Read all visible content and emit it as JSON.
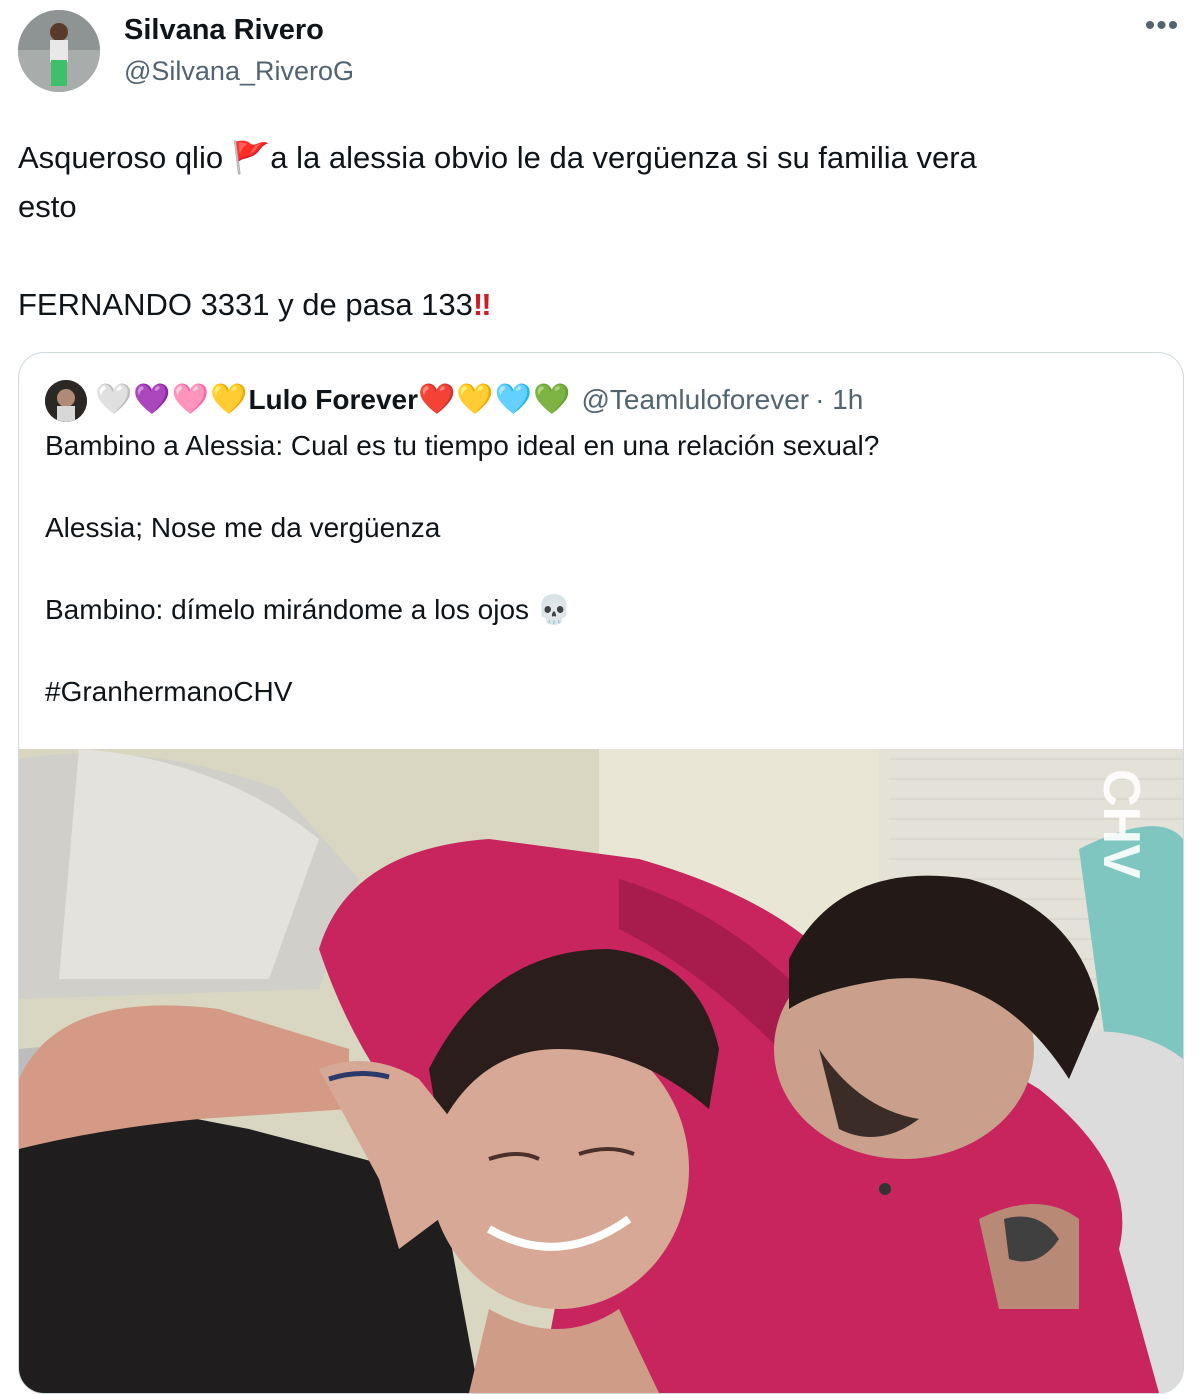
{
  "author": {
    "name": "Silvana Rivero",
    "handle": "@Silvana_RiveroG"
  },
  "more_label": "•••",
  "tweet": {
    "line1_before": "Asqueroso qlio ",
    "line1_emoji": "🚩",
    "line1_after": "a la alessia obvio le da vergüenza si su familia vera",
    "line2": "esto",
    "line3_text": "FERNANDO 3331 y de pasa 133",
    "line3_emoji": "‼"
  },
  "quote": {
    "name": "Lulo Forever",
    "name_prefix_hearts": [
      "🤍",
      "💜",
      "🩷",
      "💛"
    ],
    "name_suffix_hearts": [
      "❤️",
      "💛",
      "🩵",
      "💚"
    ],
    "handle": "@Teamluloforever",
    "time": "· 1h",
    "lines": [
      "Bambino a Alessia: Cual es tu tiempo ideal en una relación sexual?",
      "Alessia; Nose me da vergüenza",
      "Bambino: dímelo mirándome a los ojos",
      "#GranhermanoCHV"
    ],
    "skull_emoji": "💀",
    "watermark": "CHV"
  },
  "colors": {
    "text": "#0f1419",
    "secondary": "#536471",
    "border": "#cfd9de",
    "pink_hoodie": "#c8245e"
  }
}
